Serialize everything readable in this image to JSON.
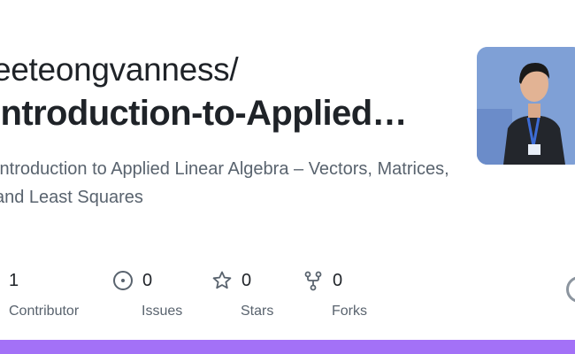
{
  "repo": {
    "owner": "eeteongvanness/",
    "name": "Introduction-to-Applied…",
    "description": "Introduction to Applied Linear Algebra – Vectors, Matrices, and Least Squares"
  },
  "stats": [
    {
      "value": "1",
      "label": "Contributor",
      "icon": "people-icon"
    },
    {
      "value": "0",
      "label": "Issues",
      "icon": "issue-icon"
    },
    {
      "value": "0",
      "label": "Stars",
      "icon": "star-icon"
    },
    {
      "value": "0",
      "label": "Forks",
      "icon": "fork-icon"
    }
  ],
  "colors": {
    "accent_bar": "#a371f7",
    "text": "#1f2328",
    "muted": "#59636e"
  }
}
